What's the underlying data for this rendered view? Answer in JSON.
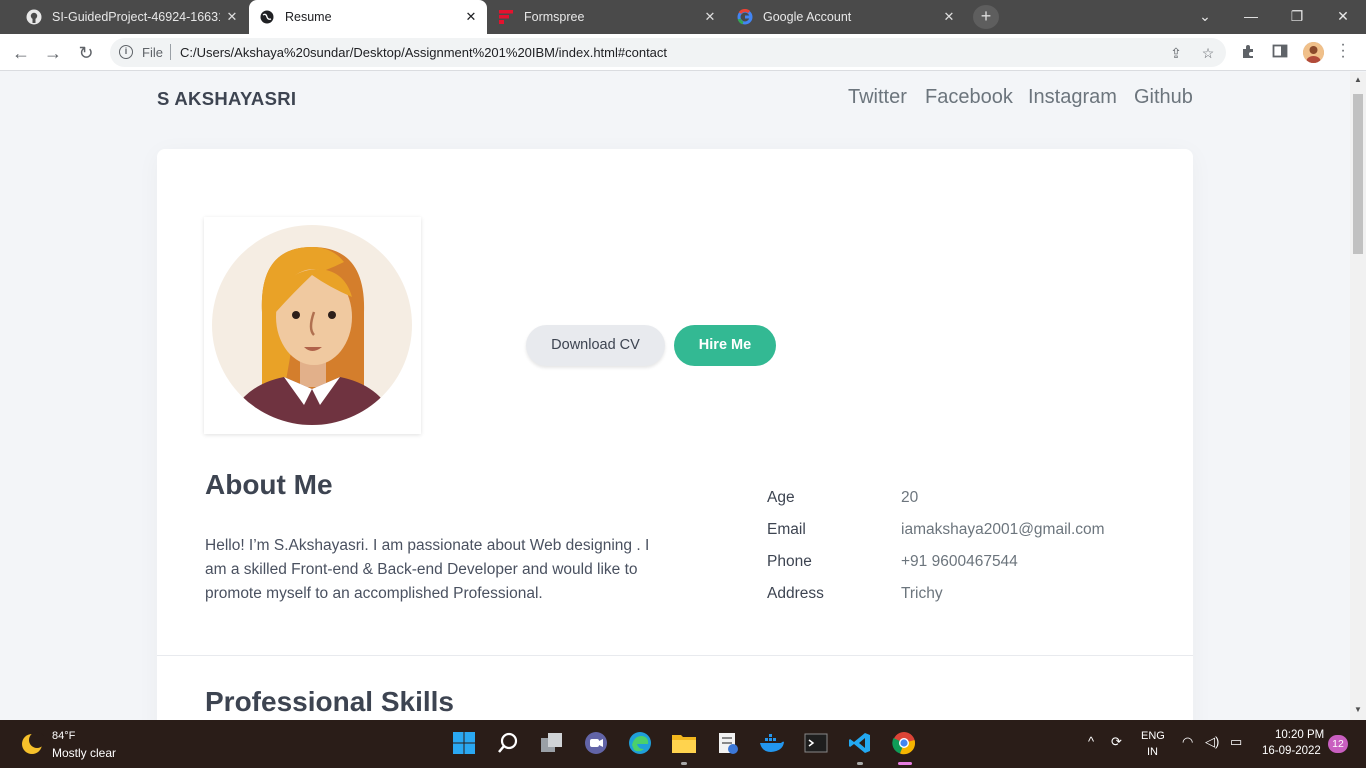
{
  "browser": {
    "tabs": [
      {
        "title": "SI-GuidedProject-46924-16631…",
        "icon": "github-icon",
        "close": "✕"
      },
      {
        "title": "Resume",
        "icon": "globe-icon",
        "close": "✕"
      },
      {
        "title": "Formspree",
        "icon": "formspree-icon",
        "close": "✕"
      },
      {
        "title": "Google Account",
        "icon": "google-icon",
        "close": "✕"
      }
    ],
    "new_tab": "+",
    "address": {
      "scheme_label": "File",
      "url": "C:/Users/Akshaya%20sundar/Desktop/Assignment%201%20IBM/index.html#contact"
    }
  },
  "site": {
    "brand": "S AKSHAYASRI",
    "nav": [
      "Twitter",
      "Facebook",
      "Instagram",
      "Github"
    ],
    "buttons": {
      "download_cv": "Download CV",
      "hire_me": "Hire Me"
    },
    "about": {
      "heading": "About Me",
      "text": "Hello! I’m S.Akshayasri. I am passionate about Web designing . I am a skilled Front-end & Back-end Developer and would like to promote myself to an accomplished Professional."
    },
    "info": [
      {
        "label": "Age",
        "value": "20"
      },
      {
        "label": "Email",
        "value": "iamakshaya2001@gmail.com"
      },
      {
        "label": "Phone",
        "value": "+91 9600467544"
      },
      {
        "label": "Address",
        "value": "Trichy"
      }
    ],
    "skills_heading": "Professional Skills",
    "colors": {
      "accent": "#33b993",
      "heading": "#3d4451"
    }
  },
  "taskbar": {
    "weather": {
      "temp": "84°F",
      "desc": "Mostly clear"
    },
    "lang": {
      "line1": "ENG",
      "line2": "IN"
    },
    "clock": {
      "time": "10:20 PM",
      "date": "16-09-2022"
    },
    "notifications": "12"
  }
}
